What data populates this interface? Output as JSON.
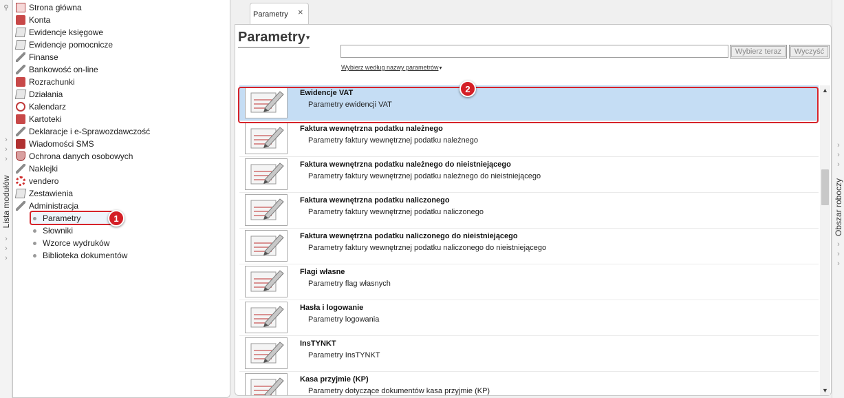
{
  "left_strip": {
    "label": "Lista modułów"
  },
  "right_strip": {
    "label": "Obszar roboczy"
  },
  "modules": [
    {
      "label": "Strona główna",
      "icon": "home-icon"
    },
    {
      "label": "Konta",
      "icon": "accounts-icon"
    },
    {
      "label": "Ewidencje księgowe",
      "icon": "ledger-icon"
    },
    {
      "label": "Ewidencje pomocnicze",
      "icon": "ledger-icon"
    },
    {
      "label": "Finanse",
      "icon": "finance-icon"
    },
    {
      "label": "Bankowość on-line",
      "icon": "bank-icon"
    },
    {
      "label": "Rozrachunki",
      "icon": "settlements-icon"
    },
    {
      "label": "Działania",
      "icon": "actions-icon"
    },
    {
      "label": "Kalendarz",
      "icon": "calendar-icon"
    },
    {
      "label": "Kartoteki",
      "icon": "records-icon"
    },
    {
      "label": "Deklaracje i e-Sprawozdawczość",
      "icon": "declarations-icon"
    },
    {
      "label": "Wiadomości SMS",
      "icon": "sms-icon"
    },
    {
      "label": "Ochrona danych osobowych",
      "icon": "shield-icon"
    },
    {
      "label": "Naklejki",
      "icon": "sticker-icon"
    },
    {
      "label": "vendero",
      "icon": "vendero-icon"
    },
    {
      "label": "Zestawienia",
      "icon": "reports-icon"
    },
    {
      "label": "Administracja",
      "icon": "admin-icon"
    }
  ],
  "admin_sub": [
    {
      "label": "Parametry"
    },
    {
      "label": "Słowniki"
    },
    {
      "label": "Wzorce wydruków"
    },
    {
      "label": "Biblioteka dokumentów"
    }
  ],
  "badges": {
    "one": "1",
    "two": "2"
  },
  "tab": {
    "label": "Parametry",
    "close": "×"
  },
  "page": {
    "title": "Parametry",
    "caret": "▾"
  },
  "search": {
    "value": "",
    "placeholder": ""
  },
  "buttons": {
    "select_now": "Wybierz teraz",
    "clear": "Wyczyść"
  },
  "filter": {
    "label": "Wybierz według nazwy parametrów",
    "caret": "▾"
  },
  "params": [
    {
      "title": "Ewidencje VAT",
      "desc": "Parametry ewidencji VAT",
      "selected": true
    },
    {
      "title": "Faktura wewnętrzna podatku należnego",
      "desc": "Parametry faktury wewnętrznej podatku należnego"
    },
    {
      "title": "Faktura wewnętrzna podatku należnego do nieistniejącego",
      "desc": "Parametry faktury wewnętrznej podatku należnego do nieistniejącego"
    },
    {
      "title": "Faktura wewnętrzna podatku naliczonego",
      "desc": "Parametry faktury wewnętrznej podatku naliczonego"
    },
    {
      "title": "Faktura wewnętrzna podatku naliczonego do nieistniejącego",
      "desc": "Parametry faktury wewnętrznej podatku naliczonego do nieistniejącego"
    },
    {
      "title": "Flagi własne",
      "desc": "Parametry flag własnych"
    },
    {
      "title": "Hasła i logowanie",
      "desc": "Parametry logowania"
    },
    {
      "title": "InsTYNKT",
      "desc": "Parametry InsTYNKT"
    },
    {
      "title": "Kasa przyjmie (KP)",
      "desc": "Parametry dotyczące dokumentów kasa przyjmie (KP)"
    }
  ],
  "colors": {
    "accent_red": "#d6232a",
    "selection": "#c5ddf4"
  }
}
